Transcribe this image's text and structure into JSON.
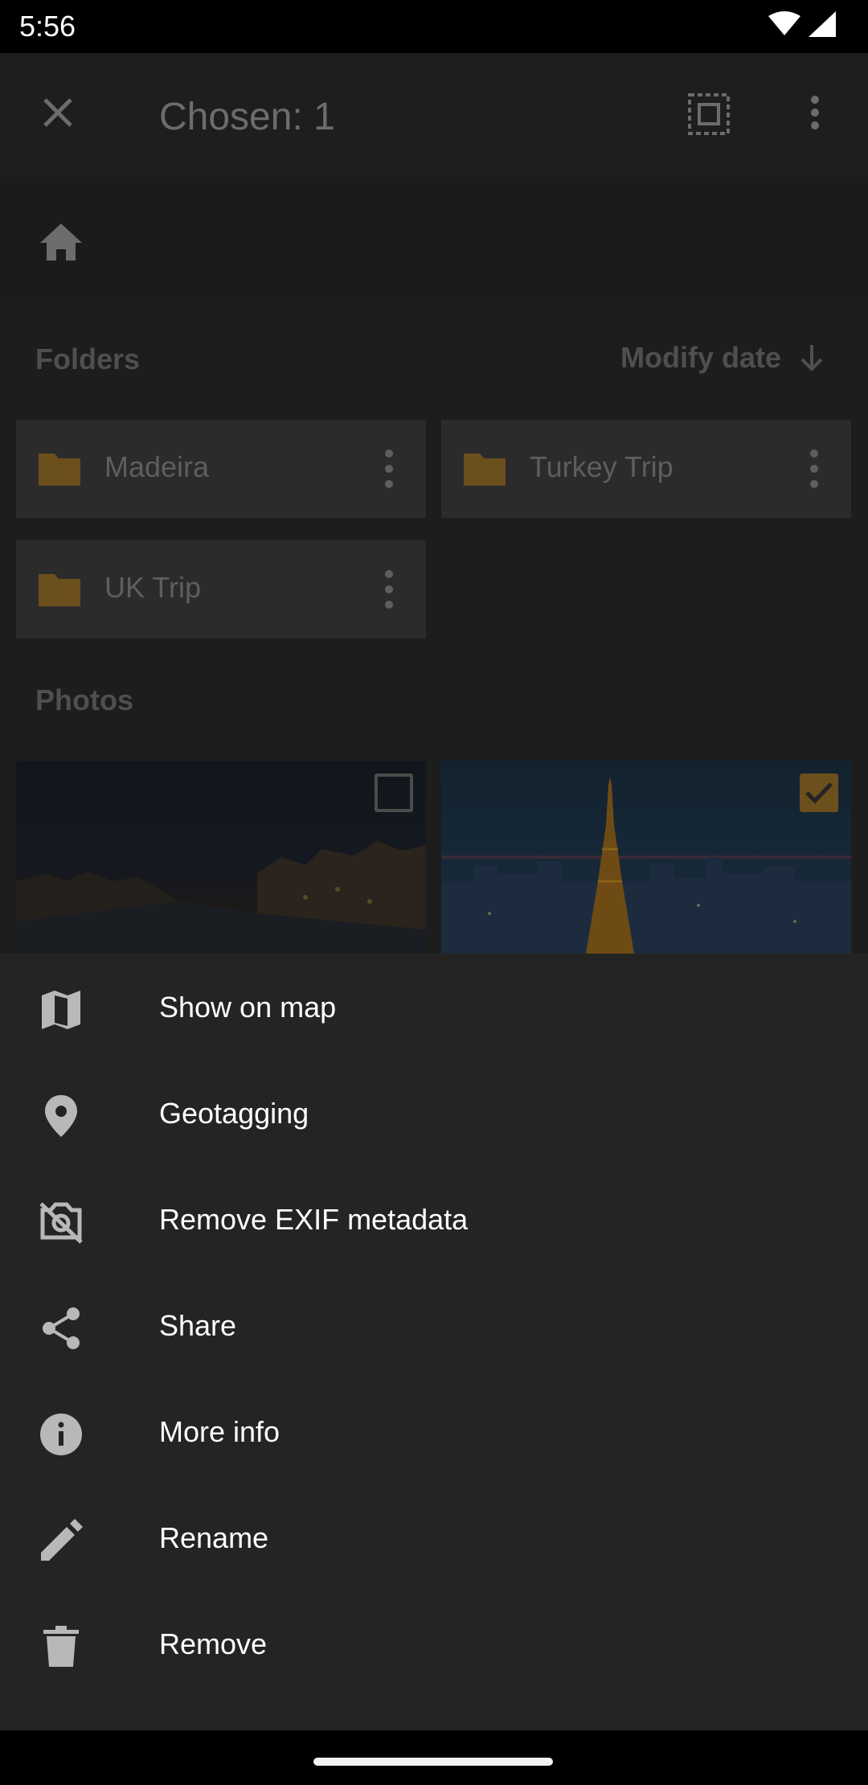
{
  "status_bar": {
    "time": "5:56"
  },
  "toolbar": {
    "title": "Chosen: 1"
  },
  "sections": {
    "folders": "Folders",
    "photos": "Photos"
  },
  "sort": {
    "label": "Modify date"
  },
  "folders": [
    {
      "name": "Madeira"
    },
    {
      "name": "Turkey Trip"
    },
    {
      "name": "UK Trip"
    }
  ],
  "photos": [
    {
      "checked": false
    },
    {
      "checked": true
    }
  ],
  "menu": [
    {
      "label": "Show on map",
      "icon": "map-icon"
    },
    {
      "label": "Geotagging",
      "icon": "location-pin-icon"
    },
    {
      "label": "Remove EXIF metadata",
      "icon": "no-camera-icon"
    },
    {
      "label": "Share",
      "icon": "share-icon"
    },
    {
      "label": "More info",
      "icon": "info-icon"
    },
    {
      "label": "Rename",
      "icon": "pencil-icon"
    },
    {
      "label": "Remove",
      "icon": "trash-icon"
    }
  ],
  "colors": {
    "accent": "#6b4f1c",
    "sheet": "#242424",
    "background": "#1d1d1d"
  }
}
